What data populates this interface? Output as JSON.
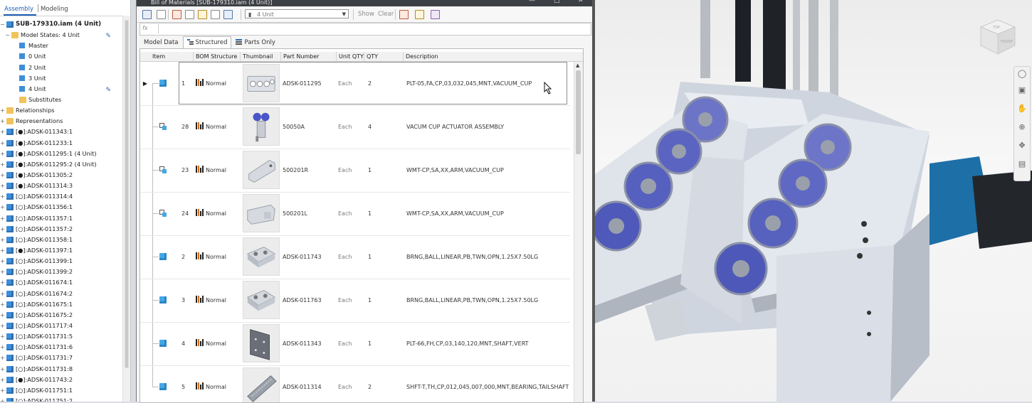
{
  "browser": {
    "tabs": [
      "Assembly",
      "Modeling"
    ],
    "items": [
      {
        "label": "SUB-179310.iam (4 Unit)",
        "level": 0,
        "icon": "assembly-icon",
        "expand": "-",
        "root": true
      },
      {
        "label": "Model States: 4 Unit",
        "level": 1,
        "icon": "folder-icon",
        "expand": "-",
        "edit": true
      },
      {
        "label": "Master",
        "level": 2,
        "icon": "model-state-icon",
        "expand": ""
      },
      {
        "label": "0 Unit",
        "level": 2,
        "icon": "model-state-icon",
        "expand": ""
      },
      {
        "label": "2 Unit",
        "level": 2,
        "icon": "model-state-icon",
        "expand": ""
      },
      {
        "label": "3 Unit",
        "level": 2,
        "icon": "model-state-icon",
        "expand": ""
      },
      {
        "label": "4 Unit",
        "level": 2,
        "icon": "model-state-active-icon",
        "expand": "",
        "edit": true
      },
      {
        "label": "Substitutes",
        "level": 2,
        "icon": "folder-icon",
        "expand": ""
      },
      {
        "label": "Relationships",
        "level": 0,
        "icon": "folder-icon",
        "expand": "+"
      },
      {
        "label": "Representations",
        "level": 0,
        "icon": "folder-icon",
        "expand": "+"
      },
      {
        "label": "[●]:ADSK-011343:1",
        "level": 0,
        "icon": "part-icon",
        "expand": "+"
      },
      {
        "label": "[●]:ADSK-011233:1",
        "level": 0,
        "icon": "part-icon",
        "expand": "+"
      },
      {
        "label": "[●]:ADSK-011295:1 (4 Unit)",
        "level": 0,
        "icon": "part-icon",
        "expand": "+"
      },
      {
        "label": "[●]:ADSK-011295:2 (4 Unit)",
        "level": 0,
        "icon": "part-icon",
        "expand": "+"
      },
      {
        "label": "[●]:ADSK-011305:2",
        "level": 0,
        "icon": "part-icon",
        "expand": "+"
      },
      {
        "label": "[●]:ADSK-011314:3",
        "level": 0,
        "icon": "part-icon",
        "expand": "+"
      },
      {
        "label": "[○]:ADSK-011314:4",
        "level": 0,
        "icon": "part-icon",
        "expand": "+"
      },
      {
        "label": "[○]:ADSK-011356:1",
        "level": 0,
        "icon": "part-icon",
        "expand": "+"
      },
      {
        "label": "[○]:ADSK-011357:1",
        "level": 0,
        "icon": "part-icon",
        "expand": "+"
      },
      {
        "label": "[○]:ADSK-011357:2",
        "level": 0,
        "icon": "part-icon",
        "expand": "+"
      },
      {
        "label": "[○]:ADSK-011358:1",
        "level": 0,
        "icon": "part-icon",
        "expand": "+"
      },
      {
        "label": "[●]:ADSK-011397:1",
        "level": 0,
        "icon": "part-icon",
        "expand": "+"
      },
      {
        "label": "[○]:ADSK-011399:1",
        "level": 0,
        "icon": "part-icon",
        "expand": "+"
      },
      {
        "label": "[○]:ADSK-011399:2",
        "level": 0,
        "icon": "part-icon",
        "expand": "+"
      },
      {
        "label": "[○]:ADSK-011674:1",
        "level": 0,
        "icon": "part-icon",
        "expand": "+"
      },
      {
        "label": "[○]:ADSK-011674:2",
        "level": 0,
        "icon": "part-icon",
        "expand": "+"
      },
      {
        "label": "[○]:ADSK-011675:1",
        "level": 0,
        "icon": "part-icon",
        "expand": "+"
      },
      {
        "label": "[○]:ADSK-011675:2",
        "level": 0,
        "icon": "part-icon",
        "expand": "+"
      },
      {
        "label": "[○]:ADSK-011717:4",
        "level": 0,
        "icon": "part-icon",
        "expand": "+"
      },
      {
        "label": "[○]:ADSK-011731:5",
        "level": 0,
        "icon": "part-icon",
        "expand": "+"
      },
      {
        "label": "[○]:ADSK-011731:6",
        "level": 0,
        "icon": "part-icon",
        "expand": "+"
      },
      {
        "label": "[○]:ADSK-011731:7",
        "level": 0,
        "icon": "part-icon",
        "expand": "+"
      },
      {
        "label": "[○]:ADSK-011731:8",
        "level": 0,
        "icon": "part-icon",
        "expand": "+"
      },
      {
        "label": "[●]:ADSK-011743:2",
        "level": 0,
        "icon": "part-icon",
        "expand": "+"
      },
      {
        "label": "[○]:ADSK-011751:1",
        "level": 0,
        "icon": "part-icon",
        "expand": "+"
      },
      {
        "label": "[○]:ADSK-011751:2",
        "level": 0,
        "icon": "part-icon",
        "expand": "+"
      }
    ]
  },
  "bom_window": {
    "title": "Bill of Materials [SUB-179310.iam (4 Unit)]",
    "model_state_select": "4 Unit",
    "show_label": "Show",
    "clear_label": "Clear",
    "formula_placeholder": "fx",
    "view_tabs": [
      "Model Data",
      "Structured",
      "Parts Only"
    ],
    "active_tab": "Structured",
    "columns": [
      "Item",
      "BOM Structure",
      "Thumbnail",
      "Part Number",
      "Unit QTY",
      "QTY",
      "Description"
    ],
    "rows": [
      {
        "item": "1",
        "bom": "Normal",
        "part": "ADSK-011295",
        "unit": "Each",
        "qty": "2",
        "desc": "PLT-05,FA,CP,03,032,045,MNT,VACUUM_CUP",
        "type": "part",
        "thumb": "plate"
      },
      {
        "item": "28",
        "bom": "Normal",
        "part": "50050A",
        "unit": "Each",
        "qty": "4",
        "desc": "VACUM CUP ACTUATOR ASSEMBLY",
        "type": "subassembly",
        "thumb": "cup"
      },
      {
        "item": "23",
        "bom": "Normal",
        "part": "500201R",
        "unit": "Each",
        "qty": "1",
        "desc": "WMT-CP,SA,XX,ARM,VACUUM_CUP",
        "type": "subassembly",
        "thumb": "arm"
      },
      {
        "item": "24",
        "bom": "Normal",
        "part": "500201L",
        "unit": "Each",
        "qty": "1",
        "desc": "WMT-CP,SA,XX,ARM,VACUUM_CUP",
        "type": "subassembly",
        "thumb": "arm2"
      },
      {
        "item": "2",
        "bom": "Normal",
        "part": "ADSK-011743",
        "unit": "Each",
        "qty": "1",
        "desc": "BRNG,BALL,LINEAR,PB,TWN,OPN,1.25X7.50LG",
        "type": "part",
        "thumb": "bearing"
      },
      {
        "item": "3",
        "bom": "Normal",
        "part": "ADSK-011763",
        "unit": "Each",
        "qty": "1",
        "desc": "BRNG,BALL,LINEAR,PB,TWN,OPN,1.25X7.50LG",
        "type": "part",
        "thumb": "bearing"
      },
      {
        "item": "4",
        "bom": "Normal",
        "part": "ADSK-011343",
        "unit": "Each",
        "qty": "1",
        "desc": "PLT-66,FH,CP,03,140,120,MNT,SHAFT,VERT",
        "type": "part",
        "thumb": "panel"
      },
      {
        "item": "5",
        "bom": "Normal",
        "part": "ADSK-011314",
        "unit": "Each",
        "qty": "2",
        "desc": "SHFT-T,TH,CP,012,045,007,000,MNT,BEARING,TAILSHAFT",
        "type": "part",
        "thumb": "shaft"
      }
    ]
  },
  "viewcube": {
    "top_label": "TOP",
    "front_label": "FRONT"
  },
  "colors": {
    "accent": "#1f5fb4",
    "cup_blue": "#4a56c8",
    "motor_blue": "#1d6fa8"
  }
}
